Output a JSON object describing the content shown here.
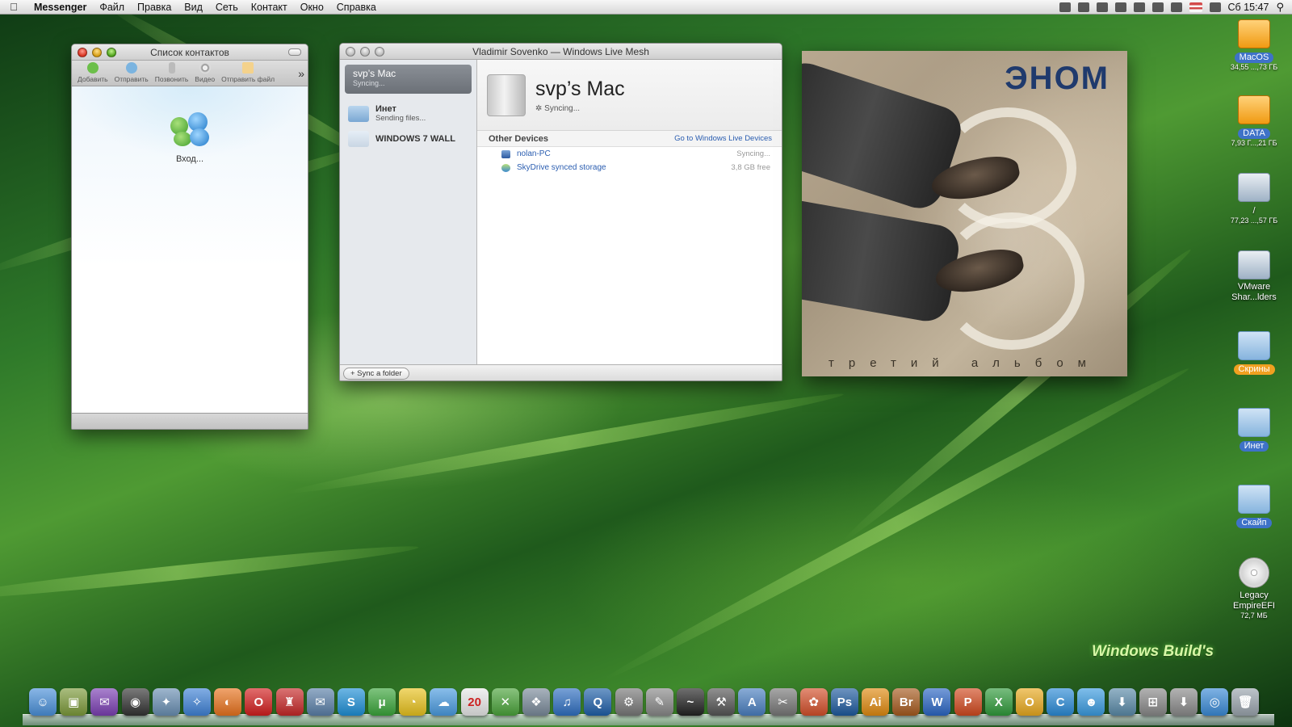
{
  "menubar": {
    "apple": "",
    "app": "Messenger",
    "items": [
      "Файл",
      "Правка",
      "Вид",
      "Сеть",
      "Контакт",
      "Окно",
      "Справка"
    ],
    "clock": "Сб 15:47"
  },
  "messenger": {
    "title": "Список контактов",
    "toolbar": {
      "add": "Добавить",
      "send": "Отправить",
      "call": "Позвонить",
      "video": "Видео",
      "send_file": "Отправить файл",
      "more": "»"
    },
    "status": "Вход..."
  },
  "mesh": {
    "title": "Vladimir Sovenko — Windows Live Mesh",
    "sidebar": {
      "selected_title": "svp’s Mac",
      "selected_sub": "Syncing...",
      "items": [
        {
          "title": "Инет",
          "sub": "Sending files..."
        },
        {
          "title": "WINDOWS 7 WALL",
          "sub": ""
        }
      ]
    },
    "device_title": "svp’s Mac",
    "device_status": "Syncing...",
    "other_devices_label": "Other Devices",
    "go_link": "Go to Windows Live Devices",
    "devices": [
      {
        "name": "nolan-PC",
        "status": "Syncing..."
      },
      {
        "name": "SkyDrive synced storage",
        "status": "3,8 GB free"
      }
    ],
    "sync_button": "+ Sync a folder"
  },
  "album": {
    "title": "ЭНОМ",
    "subtitle": "третий альбом"
  },
  "desktop_icons": [
    {
      "label": "MacOS",
      "sub": "34,55 ...,73 ГБ",
      "kind": "hd"
    },
    {
      "label": "DATA",
      "sub": "7,93 Г...,21 ГБ",
      "kind": "hd"
    },
    {
      "label": "/",
      "sub": "77,23 ...,57 ГБ",
      "kind": "net"
    },
    {
      "label": "VMware Shar...lders",
      "sub": "",
      "kind": "net"
    },
    {
      "label": "Скрины",
      "sub": "",
      "kind": "fold"
    },
    {
      "label": "Инет",
      "sub": "",
      "kind": "fold"
    },
    {
      "label": "Скайп",
      "sub": "",
      "kind": "fold"
    },
    {
      "label": "Legacy EmpireEFI",
      "sub": "72,7 МБ",
      "kind": "cd"
    }
  ],
  "watermark": "Windows Build's",
  "dock": {
    "items": [
      {
        "name": "finder-icon",
        "glyph": "☺",
        "color": "#4a90d9"
      },
      {
        "name": "cube-app-icon",
        "glyph": "▣",
        "color": "#7c9a3a"
      },
      {
        "name": "purple-app-icon",
        "glyph": "✉",
        "color": "#7b3fb3"
      },
      {
        "name": "dashboard-icon",
        "glyph": "◉",
        "color": "#333"
      },
      {
        "name": "preview-icon",
        "glyph": "✦",
        "color": "#6a8fb3"
      },
      {
        "name": "safari-icon",
        "glyph": "✧",
        "color": "#3f82d6"
      },
      {
        "name": "firefox-icon",
        "glyph": "◐",
        "color": "#e8731e"
      },
      {
        "name": "opera-icon",
        "glyph": "O",
        "color": "#d21e1e"
      },
      {
        "name": "red-app-icon",
        "glyph": "♜",
        "color": "#c62828"
      },
      {
        "name": "mail-icon",
        "glyph": "✉",
        "color": "#5a7fa8"
      },
      {
        "name": "skype-icon",
        "glyph": "S",
        "color": "#1e8fd6"
      },
      {
        "name": "utorrent-icon",
        "glyph": "μ",
        "color": "#3aa53a"
      },
      {
        "name": "adium-icon",
        "glyph": "◔",
        "color": "#e8c21e"
      },
      {
        "name": "ichat-icon",
        "glyph": "☁",
        "color": "#4a9be0"
      },
      {
        "name": "ical-icon",
        "glyph": "20",
        "color": "#e8e8e8"
      },
      {
        "name": "x11-icon",
        "glyph": "✕",
        "color": "#4aa33a"
      },
      {
        "name": "network-icon",
        "glyph": "❖",
        "color": "#7a8a9a"
      },
      {
        "name": "itunes-icon",
        "glyph": "♫",
        "color": "#2f6fc1"
      },
      {
        "name": "quicktime-icon",
        "glyph": "Q",
        "color": "#1f5fa8"
      },
      {
        "name": "system-preferences-icon",
        "glyph": "⚙",
        "color": "#777"
      },
      {
        "name": "script-icon",
        "glyph": "✎",
        "color": "#888"
      },
      {
        "name": "activity-monitor-icon",
        "glyph": "~",
        "color": "#222"
      },
      {
        "name": "utility-icon",
        "glyph": "⚒",
        "color": "#555"
      },
      {
        "name": "app-store-icon",
        "glyph": "A",
        "color": "#4a7fc0"
      },
      {
        "name": "tools-icon",
        "glyph": "✂",
        "color": "#777"
      },
      {
        "name": "picasa-icon",
        "glyph": "✿",
        "color": "#d34f2a"
      },
      {
        "name": "photoshop-icon",
        "glyph": "Ps",
        "color": "#1e5a9e"
      },
      {
        "name": "illustrator-icon",
        "glyph": "Ai",
        "color": "#e08a10"
      },
      {
        "name": "bridge-icon",
        "glyph": "Br",
        "color": "#a65a1e"
      },
      {
        "name": "word-icon",
        "glyph": "W",
        "color": "#2b66c4"
      },
      {
        "name": "powerpoint-icon",
        "glyph": "P",
        "color": "#d1491f"
      },
      {
        "name": "excel-icon",
        "glyph": "X",
        "color": "#2f9a3a"
      },
      {
        "name": "outlook-icon",
        "glyph": "O",
        "color": "#e8a91e"
      },
      {
        "name": "communicator-icon",
        "glyph": "C",
        "color": "#2a8ad6"
      },
      {
        "name": "messenger-icon",
        "glyph": "☻",
        "color": "#3a9be0"
      },
      {
        "name": "download-icon",
        "glyph": "⬇",
        "color": "#5a8aa8"
      },
      {
        "name": "windows-app-icon",
        "glyph": "⊞",
        "color": "#888"
      },
      {
        "name": "installer-icon",
        "glyph": "⬇",
        "color": "#8a8a8a"
      },
      {
        "name": "live-mesh-icon",
        "glyph": "◎",
        "color": "#3a8ad6"
      },
      {
        "name": "trash-icon",
        "glyph": "🗑",
        "color": "#9aa4ad"
      }
    ]
  }
}
